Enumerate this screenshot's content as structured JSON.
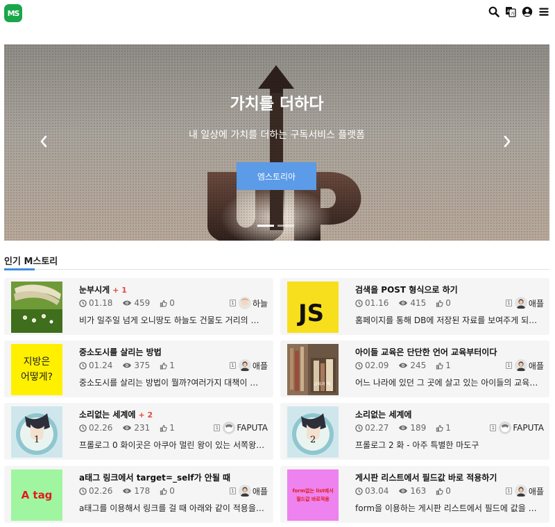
{
  "header": {
    "logo_text": "MS",
    "icons": [
      "search-icon",
      "translate-icon",
      "user-icon",
      "menu-icon"
    ]
  },
  "hero": {
    "title": "가치를 더하다",
    "subtitle": "내 일상에 가치를 더하는 구독서비스 플랫폼",
    "button_label": "엠스토리아",
    "slides_count": 2,
    "active_slide": 1
  },
  "section": {
    "title": "인기 M스토리"
  },
  "posts": [
    {
      "title": "눈부시게",
      "rank": "+ 1",
      "date": "01.18",
      "views": "459",
      "likes": "0",
      "author": "하늘",
      "desc": "비가 일주일 넘게 오니땅도 하늘도 건물도 거리의 사람…",
      "thumb": "nature"
    },
    {
      "title": "검색을 POST 형식으로 하기",
      "rank": "",
      "date": "01.16",
      "views": "415",
      "likes": "0",
      "author": "애플",
      "desc": "홈페이지를 통해 DB에 저장된 자료를 보여주게 되는데,…",
      "thumb": "js",
      "thumb_text": "JS"
    },
    {
      "title": "중소도시를 살리는 방법",
      "rank": "",
      "date": "01.24",
      "views": "375",
      "likes": "1",
      "author": "애플",
      "desc": "중소도시를 살리는 방법이 뭘까?여러가지 대책이 있을 …",
      "thumb": "yellow",
      "thumb_text": "지방은\n어떻게?"
    },
    {
      "title": "아이들 교육은 단단한 언어 교육부터이다",
      "rank": "",
      "date": "02.09",
      "views": "245",
      "likes": "1",
      "author": "애플",
      "desc": "어느 나라에 있던 그 곳에 살고 있는 아이들의 교육에 대…",
      "thumb": "books"
    },
    {
      "title": "소리없는 세계에",
      "rank": "+ 2",
      "date": "02.26",
      "views": "231",
      "likes": "1",
      "author": "FAPUTA",
      "desc": "프롤로그 0 화이곳은 아쿠아 멀린 왕이 있는 서쪽왕국, …",
      "thumb": "anime1",
      "thumb_text": "1"
    },
    {
      "title": "소리없는 세계에",
      "rank": "",
      "date": "02.27",
      "views": "189",
      "likes": "1",
      "author": "FAPUTA",
      "desc": "프롤로그 2 화 - 아주 특별한 마도구",
      "thumb": "anime2",
      "thumb_text": "2"
    },
    {
      "title": "a태그 링크에서 target=_self가 안될 때",
      "rank": "",
      "date": "02.26",
      "views": "178",
      "likes": "0",
      "author": "애플",
      "desc": "a태그를 이용해서 링크를 걸 때 아래와 같이 적용을 합니…",
      "thumb": "atag",
      "thumb_text": "A tag"
    },
    {
      "title": "게시판 리스트에서 필드값 바로 적용하기",
      "rank": "",
      "date": "03.04",
      "views": "163",
      "likes": "0",
      "author": "애플",
      "desc": "form을 이용하는 게시판 리스트에서 필드에 값을 넣기 …",
      "thumb": "form",
      "thumb_text": "form없는 list에서\n필드값 바로적용"
    }
  ],
  "colors": {
    "brand": "#1aa64a",
    "accent": "#3b8be0",
    "hero_button": "#5b9be8",
    "rank": "#e4483a"
  }
}
